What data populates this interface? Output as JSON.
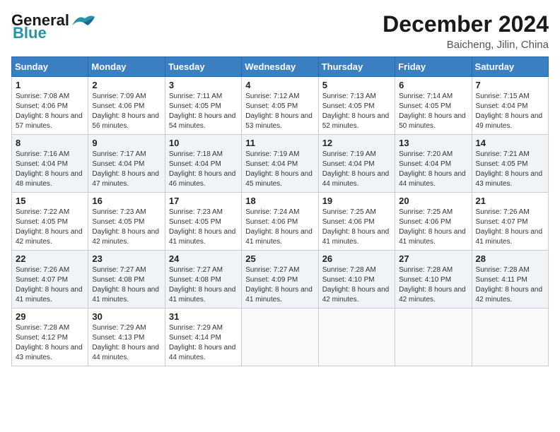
{
  "header": {
    "logo_line1": "General",
    "logo_line2": "Blue",
    "month_year": "December 2024",
    "location": "Baicheng, Jilin, China"
  },
  "weekdays": [
    "Sunday",
    "Monday",
    "Tuesday",
    "Wednesday",
    "Thursday",
    "Friday",
    "Saturday"
  ],
  "weeks": [
    [
      {
        "day": "1",
        "sunrise": "Sunrise: 7:08 AM",
        "sunset": "Sunset: 4:06 PM",
        "daylight": "Daylight: 8 hours and 57 minutes."
      },
      {
        "day": "2",
        "sunrise": "Sunrise: 7:09 AM",
        "sunset": "Sunset: 4:06 PM",
        "daylight": "Daylight: 8 hours and 56 minutes."
      },
      {
        "day": "3",
        "sunrise": "Sunrise: 7:11 AM",
        "sunset": "Sunset: 4:05 PM",
        "daylight": "Daylight: 8 hours and 54 minutes."
      },
      {
        "day": "4",
        "sunrise": "Sunrise: 7:12 AM",
        "sunset": "Sunset: 4:05 PM",
        "daylight": "Daylight: 8 hours and 53 minutes."
      },
      {
        "day": "5",
        "sunrise": "Sunrise: 7:13 AM",
        "sunset": "Sunset: 4:05 PM",
        "daylight": "Daylight: 8 hours and 52 minutes."
      },
      {
        "day": "6",
        "sunrise": "Sunrise: 7:14 AM",
        "sunset": "Sunset: 4:05 PM",
        "daylight": "Daylight: 8 hours and 50 minutes."
      },
      {
        "day": "7",
        "sunrise": "Sunrise: 7:15 AM",
        "sunset": "Sunset: 4:04 PM",
        "daylight": "Daylight: 8 hours and 49 minutes."
      }
    ],
    [
      {
        "day": "8",
        "sunrise": "Sunrise: 7:16 AM",
        "sunset": "Sunset: 4:04 PM",
        "daylight": "Daylight: 8 hours and 48 minutes."
      },
      {
        "day": "9",
        "sunrise": "Sunrise: 7:17 AM",
        "sunset": "Sunset: 4:04 PM",
        "daylight": "Daylight: 8 hours and 47 minutes."
      },
      {
        "day": "10",
        "sunrise": "Sunrise: 7:18 AM",
        "sunset": "Sunset: 4:04 PM",
        "daylight": "Daylight: 8 hours and 46 minutes."
      },
      {
        "day": "11",
        "sunrise": "Sunrise: 7:19 AM",
        "sunset": "Sunset: 4:04 PM",
        "daylight": "Daylight: 8 hours and 45 minutes."
      },
      {
        "day": "12",
        "sunrise": "Sunrise: 7:19 AM",
        "sunset": "Sunset: 4:04 PM",
        "daylight": "Daylight: 8 hours and 44 minutes."
      },
      {
        "day": "13",
        "sunrise": "Sunrise: 7:20 AM",
        "sunset": "Sunset: 4:04 PM",
        "daylight": "Daylight: 8 hours and 44 minutes."
      },
      {
        "day": "14",
        "sunrise": "Sunrise: 7:21 AM",
        "sunset": "Sunset: 4:05 PM",
        "daylight": "Daylight: 8 hours and 43 minutes."
      }
    ],
    [
      {
        "day": "15",
        "sunrise": "Sunrise: 7:22 AM",
        "sunset": "Sunset: 4:05 PM",
        "daylight": "Daylight: 8 hours and 42 minutes."
      },
      {
        "day": "16",
        "sunrise": "Sunrise: 7:23 AM",
        "sunset": "Sunset: 4:05 PM",
        "daylight": "Daylight: 8 hours and 42 minutes."
      },
      {
        "day": "17",
        "sunrise": "Sunrise: 7:23 AM",
        "sunset": "Sunset: 4:05 PM",
        "daylight": "Daylight: 8 hours and 41 minutes."
      },
      {
        "day": "18",
        "sunrise": "Sunrise: 7:24 AM",
        "sunset": "Sunset: 4:06 PM",
        "daylight": "Daylight: 8 hours and 41 minutes."
      },
      {
        "day": "19",
        "sunrise": "Sunrise: 7:25 AM",
        "sunset": "Sunset: 4:06 PM",
        "daylight": "Daylight: 8 hours and 41 minutes."
      },
      {
        "day": "20",
        "sunrise": "Sunrise: 7:25 AM",
        "sunset": "Sunset: 4:06 PM",
        "daylight": "Daylight: 8 hours and 41 minutes."
      },
      {
        "day": "21",
        "sunrise": "Sunrise: 7:26 AM",
        "sunset": "Sunset: 4:07 PM",
        "daylight": "Daylight: 8 hours and 41 minutes."
      }
    ],
    [
      {
        "day": "22",
        "sunrise": "Sunrise: 7:26 AM",
        "sunset": "Sunset: 4:07 PM",
        "daylight": "Daylight: 8 hours and 41 minutes."
      },
      {
        "day": "23",
        "sunrise": "Sunrise: 7:27 AM",
        "sunset": "Sunset: 4:08 PM",
        "daylight": "Daylight: 8 hours and 41 minutes."
      },
      {
        "day": "24",
        "sunrise": "Sunrise: 7:27 AM",
        "sunset": "Sunset: 4:08 PM",
        "daylight": "Daylight: 8 hours and 41 minutes."
      },
      {
        "day": "25",
        "sunrise": "Sunrise: 7:27 AM",
        "sunset": "Sunset: 4:09 PM",
        "daylight": "Daylight: 8 hours and 41 minutes."
      },
      {
        "day": "26",
        "sunrise": "Sunrise: 7:28 AM",
        "sunset": "Sunset: 4:10 PM",
        "daylight": "Daylight: 8 hours and 42 minutes."
      },
      {
        "day": "27",
        "sunrise": "Sunrise: 7:28 AM",
        "sunset": "Sunset: 4:10 PM",
        "daylight": "Daylight: 8 hours and 42 minutes."
      },
      {
        "day": "28",
        "sunrise": "Sunrise: 7:28 AM",
        "sunset": "Sunset: 4:11 PM",
        "daylight": "Daylight: 8 hours and 42 minutes."
      }
    ],
    [
      {
        "day": "29",
        "sunrise": "Sunrise: 7:28 AM",
        "sunset": "Sunset: 4:12 PM",
        "daylight": "Daylight: 8 hours and 43 minutes."
      },
      {
        "day": "30",
        "sunrise": "Sunrise: 7:29 AM",
        "sunset": "Sunset: 4:13 PM",
        "daylight": "Daylight: 8 hours and 44 minutes."
      },
      {
        "day": "31",
        "sunrise": "Sunrise: 7:29 AM",
        "sunset": "Sunset: 4:14 PM",
        "daylight": "Daylight: 8 hours and 44 minutes."
      },
      null,
      null,
      null,
      null
    ]
  ]
}
